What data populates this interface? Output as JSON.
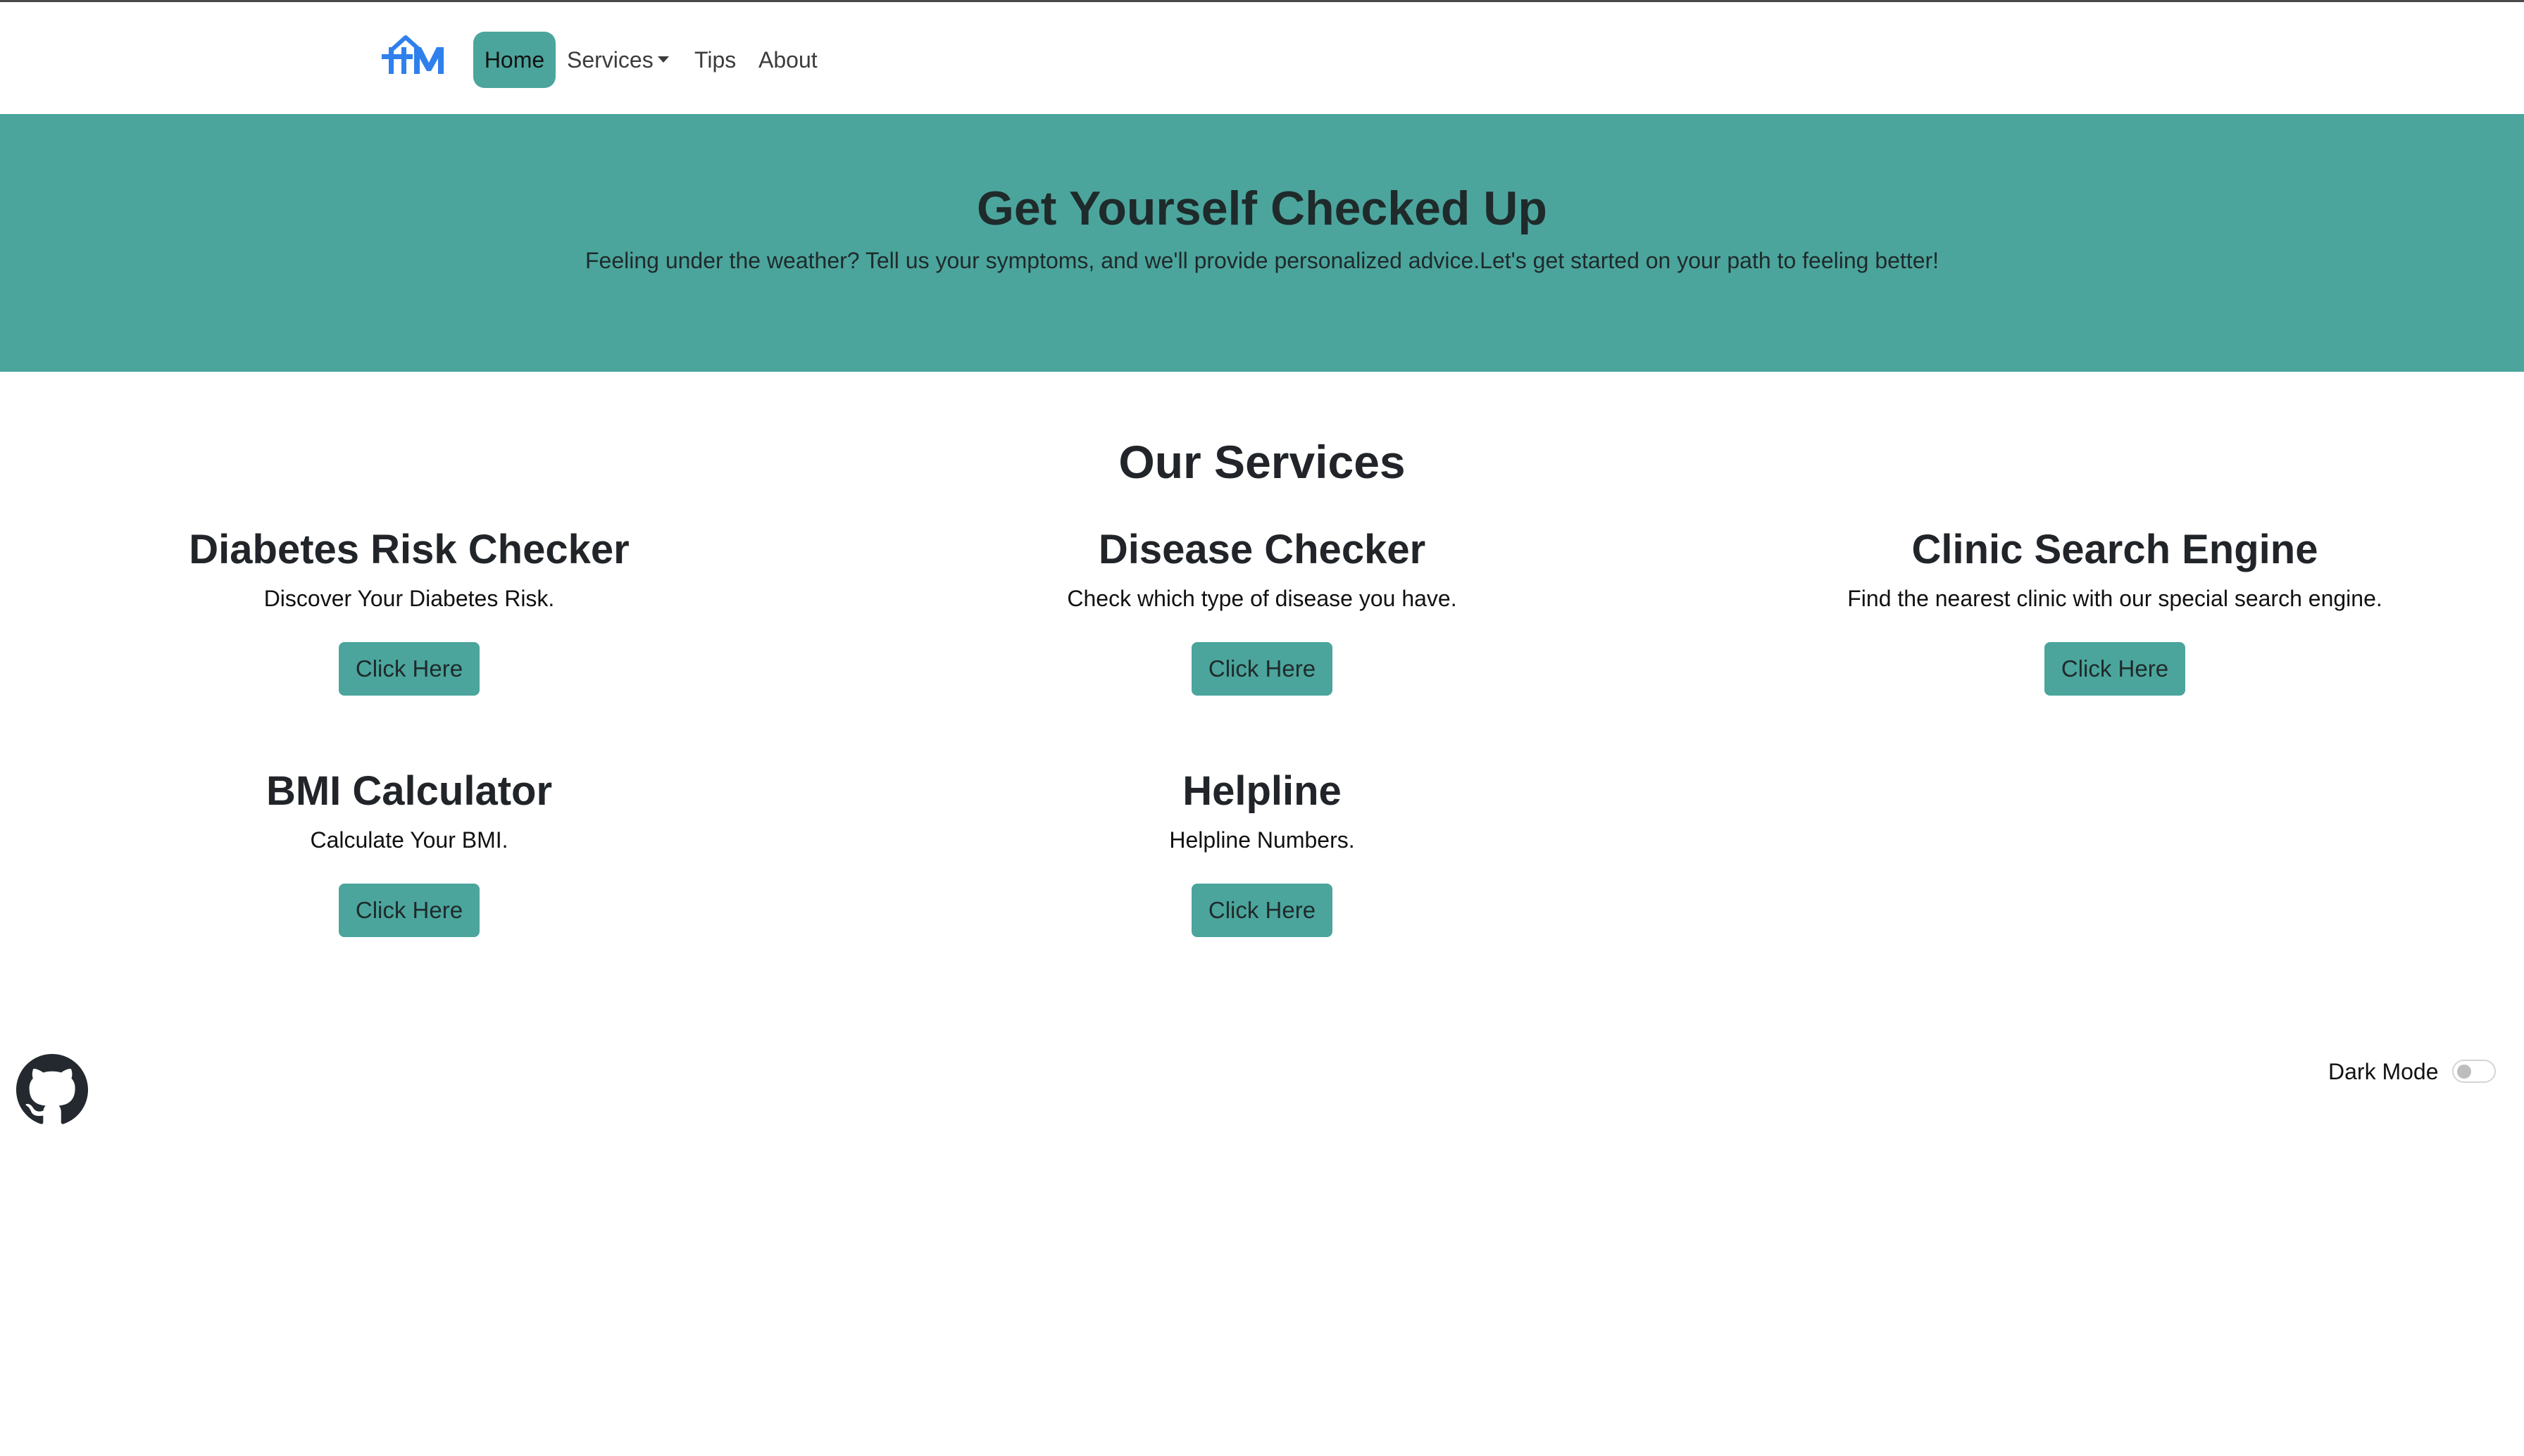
{
  "nav": {
    "logo_icon": "home-medical-logo-icon",
    "items": [
      {
        "label": "Home",
        "active": true
      },
      {
        "label": "Services",
        "dropdown": true
      },
      {
        "label": "Tips"
      },
      {
        "label": "About"
      }
    ]
  },
  "hero": {
    "title": "Get Yourself Checked Up",
    "text": "Feeling under the weather? Tell us your symptoms, and we'll provide personalized advice.Let's get started on your path to feeling better!"
  },
  "services": {
    "heading": "Our Services",
    "cards": [
      {
        "title": "Diabetes Risk Checker",
        "description": "Discover Your Diabetes Risk.",
        "button": "Click Here"
      },
      {
        "title": "Disease Checker",
        "description": "Check which type of disease you have.",
        "button": "Click Here"
      },
      {
        "title": "Clinic Search Engine",
        "description": "Find the nearest clinic with our special search engine.",
        "button": "Click Here"
      },
      {
        "title": "BMI Calculator",
        "description": "Calculate Your BMI.",
        "button": "Click Here"
      },
      {
        "title": "Helpline",
        "description": "Helpline Numbers.",
        "button": "Click Here"
      }
    ]
  },
  "footer": {
    "github_icon": "github-icon",
    "dark_mode_label": "Dark Mode",
    "dark_mode_on": false
  },
  "colors": {
    "accent": "#4ba59d",
    "logo_blue": "#2f80ed",
    "text": "#212529"
  }
}
